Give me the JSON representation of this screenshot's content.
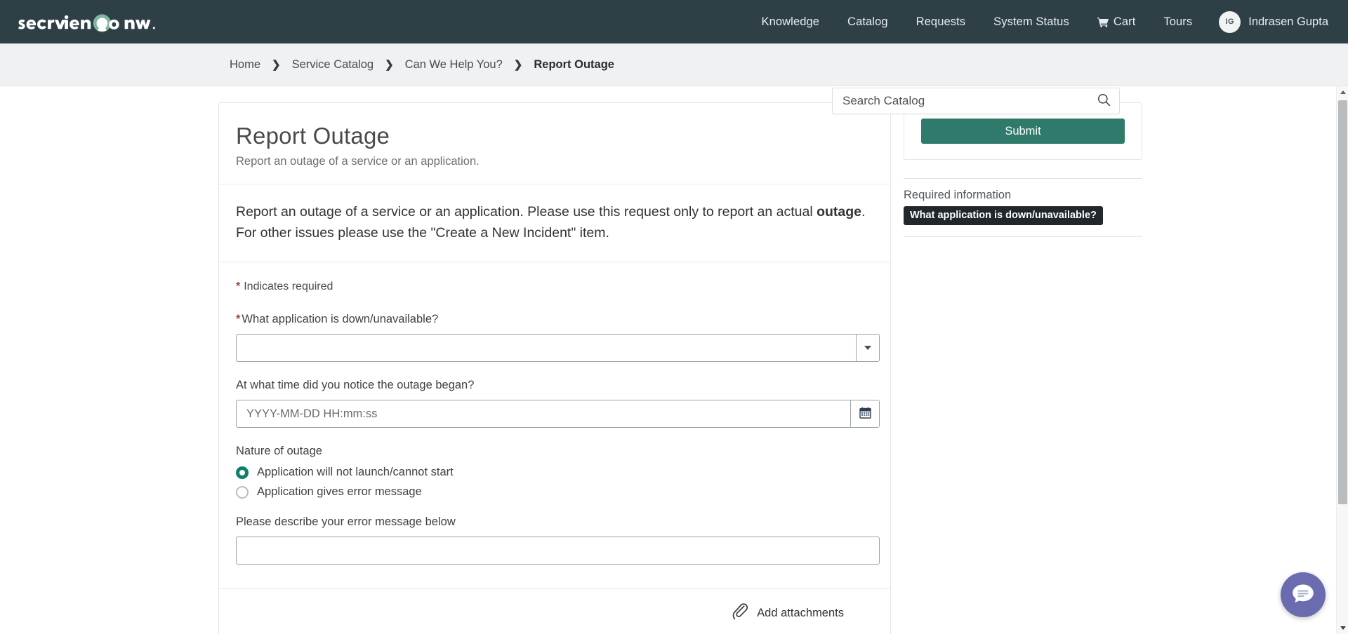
{
  "brand": {
    "logo_text": "servicenow",
    "logo_tm": "™",
    "accent_green": "#81b5a1",
    "nav_bg": "#2e4045",
    "submit_green": "#2f7a6b",
    "required_red": "#a8403c",
    "chat_purple": "#6b6bb0"
  },
  "topnav": {
    "links": [
      {
        "label": "Knowledge",
        "name": "nav-knowledge"
      },
      {
        "label": "Catalog",
        "name": "nav-catalog"
      },
      {
        "label": "Requests",
        "name": "nav-requests"
      },
      {
        "label": "System Status",
        "name": "nav-system-status"
      }
    ],
    "cart_label": "Cart",
    "tours_label": "Tours",
    "user": {
      "initials": "IG",
      "name": "Indrasen Gupta"
    }
  },
  "breadcrumb": {
    "items": [
      {
        "label": "Home"
      },
      {
        "label": "Service Catalog"
      },
      {
        "label": "Can We Help You?"
      },
      {
        "label": "Report Outage"
      }
    ],
    "separator": "❯"
  },
  "search": {
    "placeholder": "Search Catalog",
    "value": "",
    "icon": "search-icon"
  },
  "item": {
    "title": "Report Outage",
    "short_description": "Report an outage of a service or an application.",
    "description_part1": "Report an outage of a service or an application. Please use this request only to report an actual ",
    "description_bold": "outage",
    "description_part2": ". For other issues please use the \"Create a New Incident\" item."
  },
  "form": {
    "required_note": "Indicates required",
    "required_marker": "*",
    "fields": {
      "application": {
        "label": "What application is down/unavailable?",
        "required": true,
        "value": "",
        "placeholder": "",
        "dropdown_icon": "chevron-down-icon"
      },
      "outage_time": {
        "label": "At what time did you notice the outage began?",
        "required": false,
        "value": "",
        "placeholder": "YYYY-MM-DD HH:mm:ss",
        "calendar_icon": "calendar-icon"
      },
      "nature": {
        "label": "Nature of outage",
        "options": [
          {
            "label": "Application will not launch/cannot start",
            "selected": true
          },
          {
            "label": "Application gives error message",
            "selected": false
          }
        ]
      },
      "error_message": {
        "label": "Please describe your error message below",
        "value": "",
        "placeholder": ""
      }
    },
    "attachments_label": "Add attachments",
    "attachments_icon": "paperclip-icon"
  },
  "sidebar": {
    "submit_label": "Submit",
    "required_information_title": "Required information",
    "required_items": [
      {
        "label": "What application is down/unavailable?"
      }
    ]
  },
  "chat": {
    "icon": "chat-bubble-icon",
    "label": "Open chat"
  },
  "scrollbar": {
    "up_icon": "triangle-up-icon",
    "down_icon": "triangle-down-icon"
  }
}
